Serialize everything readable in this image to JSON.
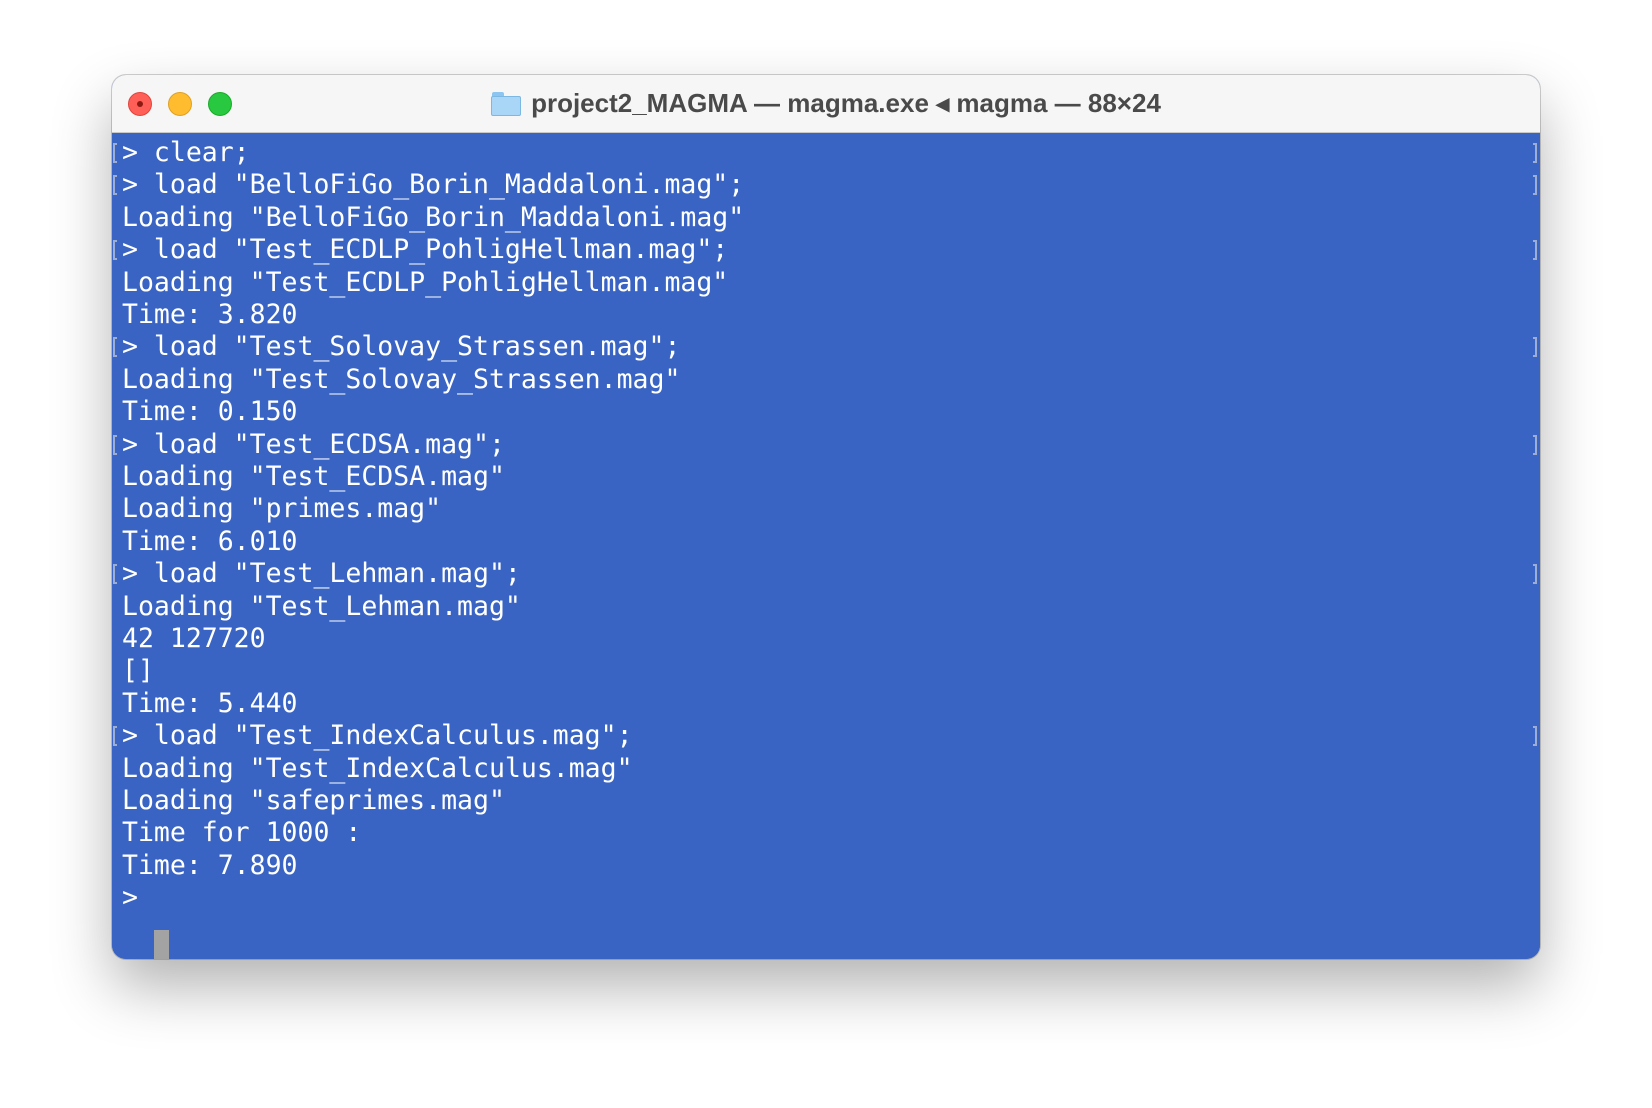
{
  "window": {
    "title": "project2_MAGMA — magma.exe ◂ magma — 88×24",
    "folder_icon": "folder-icon"
  },
  "colors": {
    "terminal_background": "#3a64c3",
    "terminal_text": "#ffffff",
    "titlebar_background": "#f6f6f6",
    "close": "#ff5f57",
    "minimize": "#febc2e",
    "maximize": "#28c840"
  },
  "terminal": {
    "lines": [
      {
        "text": "> clear;",
        "is_prompt": true
      },
      {
        "text": "> load \"BelloFiGo_Borin_Maddaloni.mag\";",
        "is_prompt": true
      },
      {
        "text": "Loading \"BelloFiGo_Borin_Maddaloni.mag\"",
        "is_prompt": false
      },
      {
        "text": "> load \"Test_ECDLP_PohligHellman.mag\";",
        "is_prompt": true
      },
      {
        "text": "Loading \"Test_ECDLP_PohligHellman.mag\"",
        "is_prompt": false
      },
      {
        "text": "Time: 3.820",
        "is_prompt": false
      },
      {
        "text": "> load \"Test_Solovay_Strassen.mag\";",
        "is_prompt": true
      },
      {
        "text": "Loading \"Test_Solovay_Strassen.mag\"",
        "is_prompt": false
      },
      {
        "text": "Time: 0.150",
        "is_prompt": false
      },
      {
        "text": "> load \"Test_ECDSA.mag\";",
        "is_prompt": true
      },
      {
        "text": "Loading \"Test_ECDSA.mag\"",
        "is_prompt": false
      },
      {
        "text": "Loading \"primes.mag\"",
        "is_prompt": false
      },
      {
        "text": "Time: 6.010",
        "is_prompt": false
      },
      {
        "text": "> load \"Test_Lehman.mag\";",
        "is_prompt": true
      },
      {
        "text": "Loading \"Test_Lehman.mag\"",
        "is_prompt": false
      },
      {
        "text": "42 127720",
        "is_prompt": false
      },
      {
        "text": "[]",
        "is_prompt": false
      },
      {
        "text": "Time: 5.440",
        "is_prompt": false
      },
      {
        "text": "> load \"Test_IndexCalculus.mag\";",
        "is_prompt": true
      },
      {
        "text": "Loading \"Test_IndexCalculus.mag\"",
        "is_prompt": false
      },
      {
        "text": "Loading \"safeprimes.mag\"",
        "is_prompt": false
      },
      {
        "text": "Time for 1000 :",
        "is_prompt": false
      },
      {
        "text": "Time: 7.890",
        "is_prompt": false
      },
      {
        "text": ">",
        "is_prompt": false
      }
    ]
  }
}
